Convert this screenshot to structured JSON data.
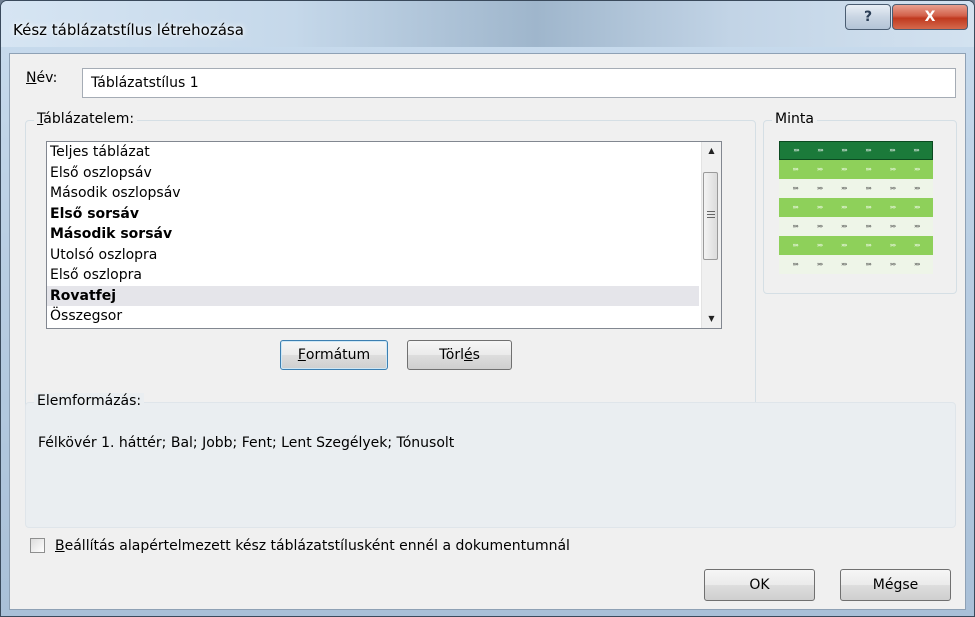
{
  "window": {
    "title": "Kész táblázatstílus létrehozása",
    "help_glyph": "?",
    "close_glyph": "X"
  },
  "name": {
    "label_accesskey": "N",
    "label_rest": "év:",
    "value": "Táblázatstílus 1"
  },
  "elements": {
    "group_label_accesskey": "T",
    "group_label_rest": "áblázatelem:",
    "items": [
      {
        "label": "Teljes táblázat",
        "bold": false,
        "selected": false
      },
      {
        "label": "Első oszlopsáv",
        "bold": false,
        "selected": false
      },
      {
        "label": "Második oszlopsáv",
        "bold": false,
        "selected": false
      },
      {
        "label": "Első sorsáv",
        "bold": true,
        "selected": false
      },
      {
        "label": "Második sorsáv",
        "bold": true,
        "selected": false
      },
      {
        "label": "Utolsó oszlopra",
        "bold": false,
        "selected": false
      },
      {
        "label": "Első oszlopra",
        "bold": false,
        "selected": false
      },
      {
        "label": "Rovatfej",
        "bold": true,
        "selected": true
      },
      {
        "label": "Összegsor",
        "bold": false,
        "selected": false
      }
    ],
    "format_button": {
      "accesskey": "F",
      "rest": "ormátum"
    },
    "clear_button": {
      "before": "Törl",
      "accesskey": "é",
      "after": "s"
    }
  },
  "sample": {
    "label": "Minta",
    "cell_glyph": "»»",
    "rows": [
      "header",
      "band",
      "plain",
      "band",
      "plain",
      "band",
      "plain"
    ]
  },
  "element_format": {
    "label": "Elemformázás:",
    "text": "Félkövér 1. háttér; Bal; Jobb; Fent; Lent Szegélyek; Tónusolt"
  },
  "default_checkbox": {
    "accesskey": "B",
    "rest": "eállítás alapértelmezett kész táblázatstílusként ennél a dokumentumnál",
    "checked": false
  },
  "buttons": {
    "ok": "OK",
    "cancel": "Mégse"
  },
  "colors": {
    "sample_header": "#1b7a3a",
    "sample_band": "#8ed05a",
    "sample_plain": "#eef5e8",
    "close_red": "#c0391f"
  }
}
